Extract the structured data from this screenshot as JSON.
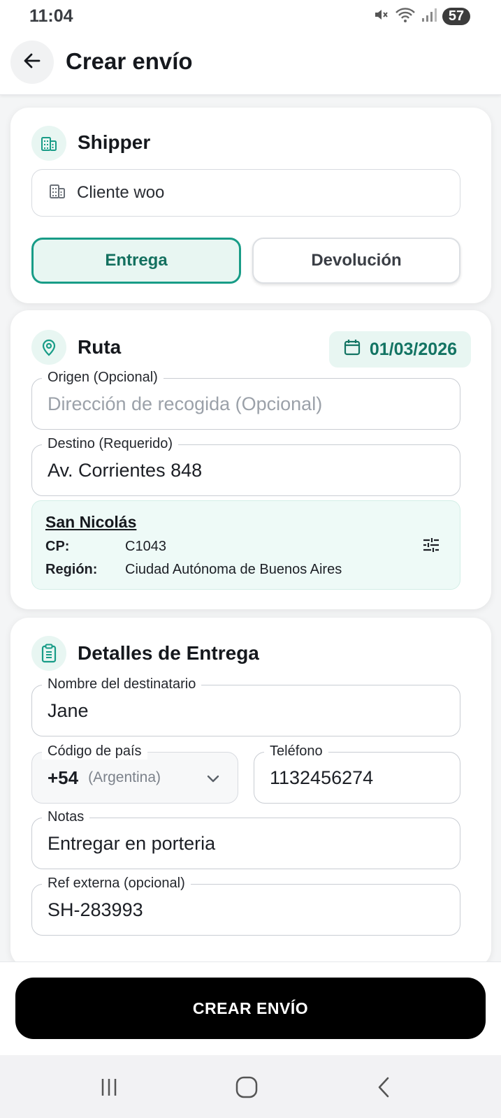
{
  "status_bar": {
    "time": "11:04",
    "battery": "57"
  },
  "header": {
    "title": "Crear envío"
  },
  "shipper_section": {
    "title": "Shipper",
    "value": "Cliente woo",
    "toggle_options": [
      "Entrega",
      "Devolución"
    ],
    "selected": "Entrega"
  },
  "route_section": {
    "title": "Ruta",
    "date": "01/03/2026",
    "origin_label": "Origen (Opcional)",
    "origin_placeholder": "Dirección de recogida (Opcional)",
    "destination_label": "Destino (Requerido)",
    "destination_value": "Av. Corrientes 848",
    "zone": {
      "name": "San Nicolás",
      "cp_label": "CP:",
      "cp_value": "C1043",
      "region_label": "Región:",
      "region_value": "Ciudad Autónoma de Buenos Aires"
    }
  },
  "delivery_section": {
    "title": "Detalles de Entrega",
    "recipient_label": "Nombre del destinatario",
    "recipient_value": "Jane",
    "country_code_label": "Código de país",
    "country_code": "+54",
    "country_name": "(Argentina)",
    "phone_label": "Teléfono",
    "phone_value": "1132456274",
    "notes_label": "Notas",
    "notes_value": "Entregar en porteria",
    "external_ref_label": "Ref externa (opcional)",
    "external_ref_value": "SH-283993"
  },
  "footer": {
    "create_button": "CREAR ENVÍO"
  },
  "colors": {
    "accent": "#189c87",
    "accent_light": "#e8f6f2",
    "primary_button": "#000000"
  },
  "icons": [
    "back-arrow-icon",
    "building-icon",
    "location-pin-icon",
    "calendar-icon",
    "sliders-icon",
    "clipboard-icon",
    "chevron-down-icon",
    "mute-icon",
    "wifi-icon",
    "signal-icon"
  ]
}
